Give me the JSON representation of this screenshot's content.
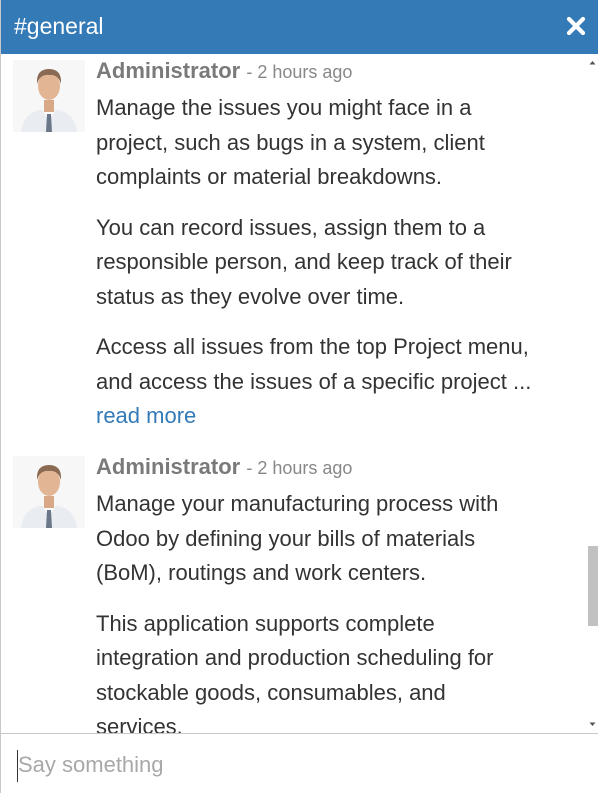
{
  "channel": {
    "title": "#general",
    "close_icon": "close-icon"
  },
  "messages": [
    {
      "author": "Administrator",
      "time": "- 2 hours ago",
      "paragraphs": [
        [
          "Manage the issues you might face in a",
          "project, such as bugs in a system, client",
          "complaints or material breakdowns."
        ],
        [
          "You can record issues, assign them to a",
          "responsible person, and keep track of their",
          "status as they evolve over time."
        ],
        [
          "Access all issues from the top Project menu,",
          "and access the issues of a specific project ..."
        ]
      ],
      "read_more": "read more"
    },
    {
      "author": "Administrator",
      "time": "- 2 hours ago",
      "paragraphs": [
        [
          "Manage your manufacturing process with",
          "Odoo by defining your bills of materials",
          "(BoM), routings and work centers."
        ],
        [
          "This application supports complete",
          "integration and production scheduling for",
          "stockable goods, consumables, and",
          "services."
        ]
      ]
    }
  ],
  "composer": {
    "placeholder": "Say something"
  },
  "colors": {
    "header": "#337ab7",
    "link": "#337ab7",
    "author": "#7a7a7a"
  }
}
